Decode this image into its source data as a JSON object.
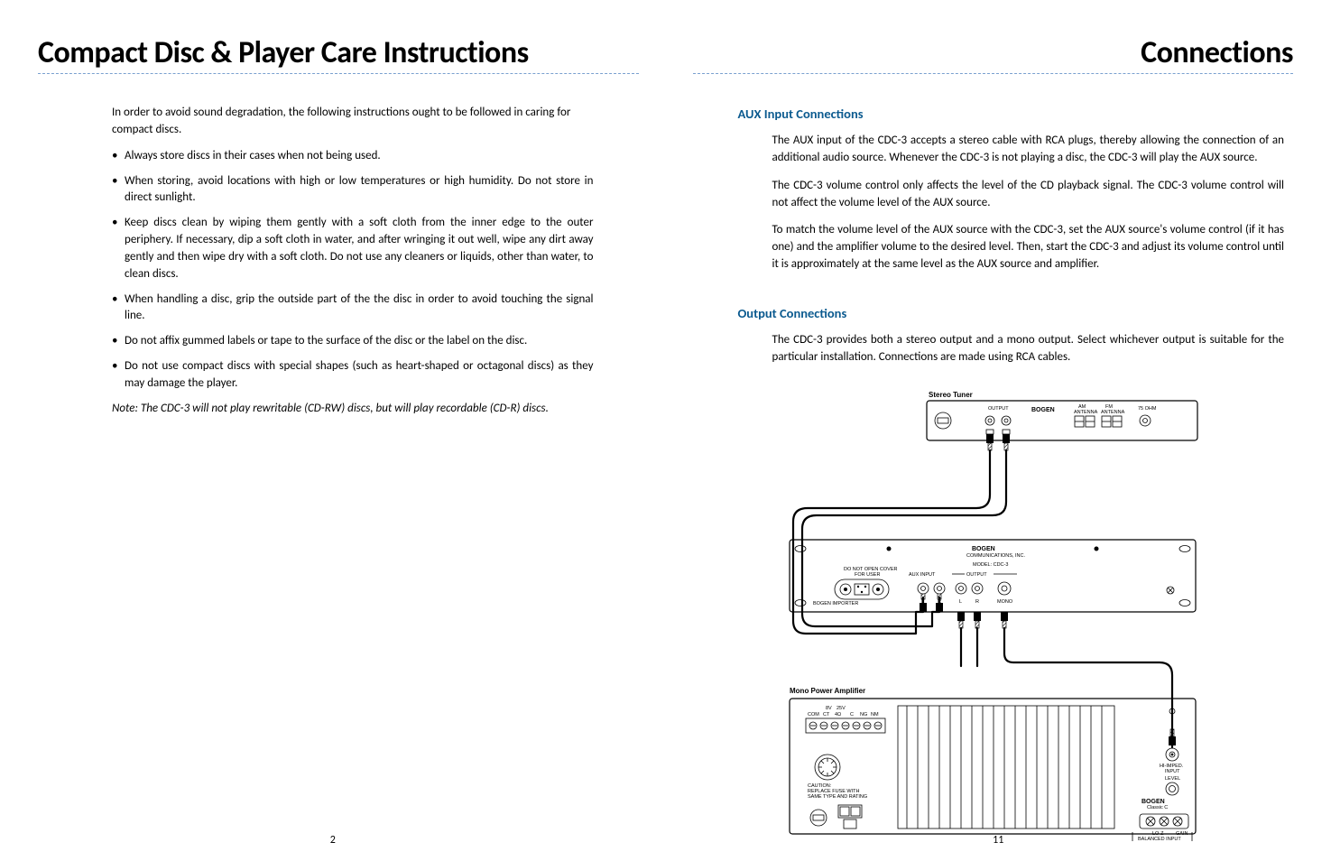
{
  "left": {
    "title": "Compact Disc & Player Care Instructions",
    "intro": "In order to avoid sound degradation, the following instructions ought to be followed in caring for compact discs.",
    "bullets": [
      "Always store discs in their cases when not being used.",
      "When storing, avoid locations with high or low temperatures or high humidity. Do not store in direct sunlight.",
      "Keep discs clean by wiping them gently with a soft cloth from the inner edge to the outer periphery. If necessary, dip a soft cloth in water, and after wringing it out well, wipe any dirt away gently and then wipe dry with a soft cloth. Do not use any cleaners or liquids, other than water, to clean discs.",
      "When handling a disc, grip the outside part of the the disc in order to avoid touching the signal line.",
      "Do not affix gummed labels or tape to the surface of the disc or the label on the disc.",
      "Do not use compact discs with special shapes (such as heart-shaped or octagonal discs) as they may damage the player."
    ],
    "note": "Note: The CDC-3 will not play rewritable (CD-RW) discs, but will play recordable (CD-R) discs.",
    "page_num": "2"
  },
  "right": {
    "title": "Connections",
    "aux_heading": "AUX Input Connections",
    "aux_p1": "The AUX input of the CDC-3 accepts a stereo cable with RCA plugs, thereby allowing the connection of an additional audio source. Whenever the CDC-3 is not playing a disc, the CDC-3 will play the AUX source.",
    "aux_p2": "The CDC-3 volume control only affects the level of the CD playback signal. The CDC-3 volume control will not affect the volume level of the AUX source.",
    "aux_p3": "To match the volume level of the AUX source with the CDC-3, set the AUX source's volume control (if it has one) and the amplifier volume to the desired level. Then, start the CDC-3 and adjust its volume control until it is approximately at the same level as the AUX source and amplifier.",
    "out_heading": "Output Connections",
    "out_p1": "The CDC-3 provides both a stereo output and a mono output. Select whichever output is suitable for the particular installation. Connections are made using RCA cables.",
    "page_num": "11",
    "diagram": {
      "tuner_label": "Stereo Tuner",
      "tuner_output": "OUTPUT",
      "tuner_brand": "BOGEN",
      "tuner_am": "AM",
      "tuner_fm": "FM",
      "tuner_fm75": "75 OHM",
      "tuner_ant_am": "ANTENNA",
      "tuner_ant_fm": "ANTENNA",
      "cdc_brand": "BOGEN",
      "cdc_brand2": "COMMUNICATIONS, INC.",
      "cdc_model": "MODEL: CDC-3",
      "cdc_warn1": "DO NOT OPEN COVER",
      "cdc_warn2": "FOR USER",
      "cdc_aux": "AUX INPUT",
      "cdc_output": "OUTPUT",
      "cdc_l": "L",
      "cdc_r": "R",
      "cdc_mono": "MONO",
      "cdc_mfg": "BOGEN IMPORTER",
      "amp_label": "Mono Power Amplifier",
      "amp_8v": "8V",
      "amp_25v": "25V",
      "amp_com": "COM",
      "amp_ct": "CT",
      "amp_4": "4Ω",
      "amp_c": "C",
      "amp_ng": "NG",
      "amp_nm": "NM",
      "amp_caution": "CAUTION:",
      "amp_caution2": "REPLACE FUSE WITH",
      "amp_caution3": "SAME TYPE AND RATING",
      "amp_brand": "BOGEN",
      "amp_model": "Classic C",
      "amp_hiinput": "HI-IMPED.",
      "amp_input": "INPUT",
      "amp_level": "LEVEL",
      "amp_loz": "LO-Z",
      "amp_balanced": "BALANCED INPUT",
      "amp_input2": "INPUT",
      "amp_gain": "GAIN"
    }
  }
}
